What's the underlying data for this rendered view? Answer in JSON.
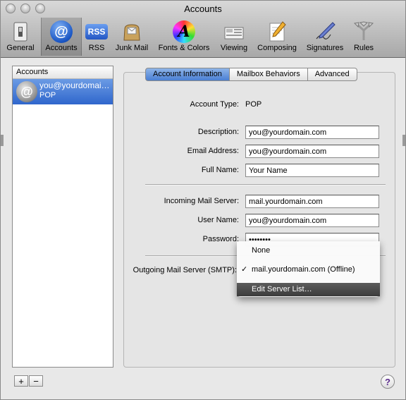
{
  "window": {
    "title": "Accounts"
  },
  "toolbar": {
    "items": [
      {
        "label": "General",
        "icon": "switch-icon"
      },
      {
        "label": "Accounts",
        "icon": "at-sign-icon",
        "selected": true
      },
      {
        "label": "RSS",
        "icon": "rss-icon"
      },
      {
        "label": "Junk Mail",
        "icon": "junk-mail-bag-icon"
      },
      {
        "label": "Fonts & Colors",
        "icon": "fonts-colors-icon"
      },
      {
        "label": "Viewing",
        "icon": "viewing-icon"
      },
      {
        "label": "Composing",
        "icon": "composing-pencil-icon"
      },
      {
        "label": "Signatures",
        "icon": "signature-pen-icon"
      },
      {
        "label": "Rules",
        "icon": "rules-arrows-icon"
      }
    ],
    "rss_badge": "RSS",
    "fonts_glyph": "A",
    "accounts_glyph": "@"
  },
  "sidebar": {
    "header": "Accounts",
    "accounts": [
      {
        "name": "you@yourdomai…",
        "type": "POP",
        "icon_glyph": "@"
      }
    ],
    "add_label": "+",
    "remove_label": "−"
  },
  "tabs": [
    {
      "label": "Account Information",
      "selected": true
    },
    {
      "label": "Mailbox Behaviors"
    },
    {
      "label": "Advanced"
    }
  ],
  "form": {
    "account_type_label": "Account Type:",
    "account_type_value": "POP",
    "description_label": "Description:",
    "description_value": "you@yourdomain.com",
    "email_label": "Email Address:",
    "email_value": "you@yourdomain.com",
    "fullname_label": "Full Name:",
    "fullname_value": "Your Name",
    "incoming_label": "Incoming Mail Server:",
    "incoming_value": "mail.yourdomain.com",
    "username_label": "User Name:",
    "username_value": "you@yourdomain.com",
    "password_label": "Password:",
    "password_value": "••••••••",
    "outgoing_label": "Outgoing Mail Server (SMTP):"
  },
  "smtp_menu": {
    "items": [
      {
        "label": "None",
        "checked": false
      },
      {
        "label": "mail.yourdomain.com (Offline)",
        "checked": true
      },
      {
        "label": "Edit Server List…",
        "highlighted": true
      }
    ],
    "check_glyph": "✓"
  },
  "help": {
    "label": "?"
  }
}
